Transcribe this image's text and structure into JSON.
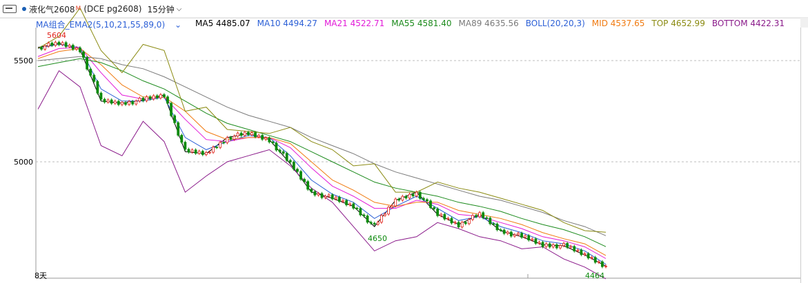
{
  "window": {
    "symbol_name": "液化气2608",
    "symbol_badge": "M",
    "exchange_code": "(DCE pg2608)",
    "period": "15分钟"
  },
  "legend": {
    "group": "MA组合_EMA2(5,10,21,55,89,0)",
    "items": [
      {
        "label": "MA5 4485.07",
        "color": "#000000"
      },
      {
        "label": "MA10 4494.27",
        "color": "#2b5fd6"
      },
      {
        "label": "MA21 4522.71",
        "color": "#e21ad8"
      },
      {
        "label": "MA55 4581.40",
        "color": "#1b8a1b"
      },
      {
        "label": "MA89 4635.56",
        "color": "#7a7a7a"
      },
      {
        "label": "BOLL(20,20,3)",
        "color": "#2b5fd6"
      },
      {
        "label": "MID 4537.65",
        "color": "#f07a10"
      },
      {
        "label": "TOP 4652.99",
        "color": "#8a8a10"
      },
      {
        "label": "BOTTOM 4422.31",
        "color": "#8a1a8a"
      }
    ]
  },
  "axis": {
    "labels": [
      "5500",
      "5000"
    ],
    "bottom_label": "8天"
  },
  "annotations": {
    "high": "5604",
    "low_mid": "4650",
    "low_end": "4464"
  },
  "colors": {
    "up": "#e0231b",
    "down": "#0c8a0c",
    "grid": "#bdbdbd"
  },
  "chart_data": {
    "type": "line",
    "y_ticks": [
      5500,
      5000
    ],
    "series": [
      {
        "name": "MA5 4485.07",
        "color": "#000000",
        "values": [
          5565,
          5585,
          5555,
          5300,
          5290,
          5305,
          5330,
          5050,
          5040,
          5120,
          5140,
          5110,
          4990,
          4850,
          4820,
          4780,
          4680,
          4810,
          4850,
          4740,
          4690,
          4740,
          4660,
          4630,
          4590,
          4585,
          4540,
          4485
        ]
      },
      {
        "name": "MA10 4494.27",
        "color": "#2b5fd6",
        "values": [
          5560,
          5580,
          5565,
          5360,
          5300,
          5300,
          5320,
          5120,
          5060,
          5100,
          5130,
          5120,
          5030,
          4910,
          4840,
          4800,
          4720,
          4780,
          4830,
          4770,
          4710,
          4730,
          4680,
          4650,
          4610,
          4595,
          4560,
          4494
        ]
      },
      {
        "name": "MA21 4522.71",
        "color": "#e21ad8",
        "values": [
          5520,
          5560,
          5565,
          5440,
          5330,
          5310,
          5320,
          5210,
          5110,
          5100,
          5120,
          5120,
          5070,
          4970,
          4880,
          4830,
          4770,
          4770,
          4810,
          4790,
          4740,
          4730,
          4700,
          4670,
          4630,
          4610,
          4580,
          4522
        ]
      },
      {
        "name": "MID 4537.65",
        "color": "#f07a10",
        "values": [
          5510,
          5545,
          5560,
          5480,
          5380,
          5320,
          5320,
          5250,
          5150,
          5110,
          5120,
          5120,
          5090,
          5000,
          4910,
          4860,
          4800,
          4780,
          4800,
          4800,
          4760,
          4740,
          4720,
          4690,
          4650,
          4620,
          4595,
          4537
        ]
      },
      {
        "name": "MA55 4581.40",
        "color": "#1b8a1b",
        "values": [
          5470,
          5490,
          5510,
          5490,
          5450,
          5400,
          5360,
          5300,
          5240,
          5190,
          5160,
          5130,
          5100,
          5050,
          5000,
          4950,
          4900,
          4870,
          4850,
          4830,
          4800,
          4780,
          4755,
          4720,
          4690,
          4665,
          4630,
          4581
        ]
      },
      {
        "name": "MA89 4635.56",
        "color": "#7a7a7a",
        "values": [
          5500,
          5510,
          5520,
          5510,
          5480,
          5460,
          5420,
          5370,
          5320,
          5270,
          5230,
          5200,
          5170,
          5120,
          5080,
          5040,
          4990,
          4950,
          4920,
          4890,
          4860,
          4830,
          4810,
          4780,
          4750,
          4710,
          4680,
          4635
        ]
      },
      {
        "name": "TOP 4652.99",
        "color": "#8a8a10",
        "values": [
          5560,
          5620,
          5760,
          5550,
          5440,
          5580,
          5550,
          5250,
          5270,
          5160,
          5150,
          5140,
          5170,
          5100,
          5060,
          4980,
          4990,
          4850,
          4850,
          4900,
          4870,
          4850,
          4820,
          4790,
          4760,
          4700,
          4660,
          4652
        ]
      },
      {
        "name": "BOTTOM 4422.31",
        "color": "#8a1a8a",
        "values": [
          5260,
          5450,
          5370,
          5080,
          5030,
          5200,
          5100,
          4850,
          4930,
          5000,
          5030,
          5060,
          4980,
          4870,
          4800,
          4680,
          4560,
          4610,
          4630,
          4700,
          4670,
          4630,
          4610,
          4570,
          4580,
          4520,
          4480,
          4422
        ]
      }
    ],
    "candles_close": [
      5565,
      5585,
      5555,
      5300,
      5290,
      5305,
      5330,
      5050,
      5040,
      5120,
      5140,
      5110,
      4990,
      4850,
      4820,
      4780,
      4680,
      4810,
      4850,
      4740,
      4690,
      4740,
      4660,
      4630,
      4590,
      4585,
      4540,
      4485
    ]
  }
}
